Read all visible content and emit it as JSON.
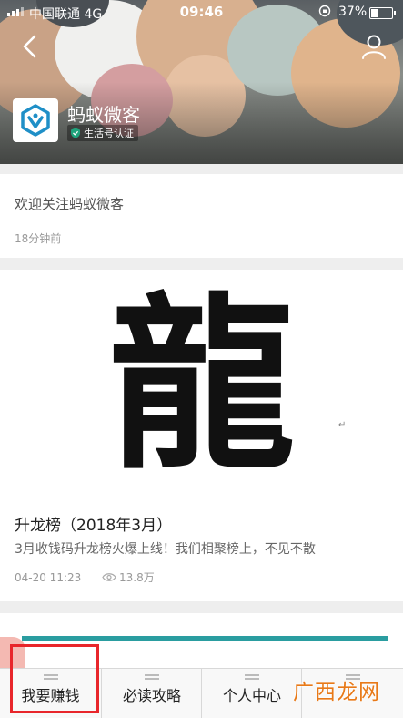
{
  "status_bar": {
    "carrier": "中国联通",
    "network": "4G",
    "time": "09:46",
    "battery_percent": "37%"
  },
  "header": {
    "account_name": "蚂蚁微客",
    "verification_label": "生活号认证",
    "back_icon": "chevron-left-icon",
    "profile_icon": "user-icon"
  },
  "welcome_message": {
    "text": "欢迎关注蚂蚁微客",
    "time_ago": "18分钟前"
  },
  "article": {
    "image_glyph": "龍",
    "title": "升龙榜（2018年3月）",
    "summary": "3月收钱码升龙榜火爆上线！我们相聚榜上，不见不散",
    "date": "04-20 11:23",
    "views": "13.8万"
  },
  "bottom_menu": {
    "items": [
      {
        "label": "我要赚钱"
      },
      {
        "label": "必读攻略"
      },
      {
        "label": "个人中心"
      }
    ]
  },
  "watermark": "广西龙网",
  "colors": {
    "accent_teal": "#2a9da0",
    "highlight_red": "#e8262b",
    "watermark_orange": "#e87918",
    "verify_green": "#1fa27b"
  }
}
